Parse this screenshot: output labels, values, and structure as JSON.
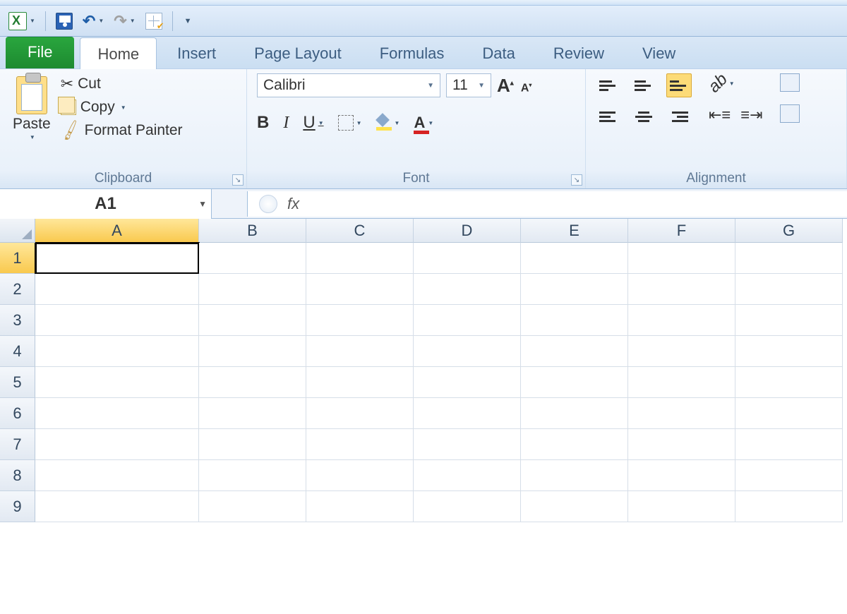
{
  "qat": {
    "icons": {
      "excel": "excel-app-icon",
      "save": "save-icon",
      "undo": "undo-icon",
      "redo": "redo-icon",
      "table": "customize-table-icon",
      "more": "customize-qat-icon"
    }
  },
  "tabs": {
    "file": "File",
    "items": [
      "Home",
      "Insert",
      "Page Layout",
      "Formulas",
      "Data",
      "Review",
      "View"
    ],
    "active": "Home"
  },
  "ribbon": {
    "clipboard": {
      "label": "Clipboard",
      "paste": "Paste",
      "cut": "Cut",
      "copy": "Copy",
      "format_painter": "Format Painter"
    },
    "font": {
      "label": "Font",
      "name": "Calibri",
      "size": "11"
    },
    "alignment": {
      "label": "Alignment"
    }
  },
  "formula_bar": {
    "name_box": "A1",
    "fx": "fx",
    "value": ""
  },
  "grid": {
    "columns": [
      "A",
      "B",
      "C",
      "D",
      "E",
      "F",
      "G"
    ],
    "rows": [
      "1",
      "2",
      "3",
      "4",
      "5",
      "6",
      "7",
      "8",
      "9"
    ],
    "selected_col": "A",
    "selected_row": "1",
    "active_cell": "A1"
  }
}
